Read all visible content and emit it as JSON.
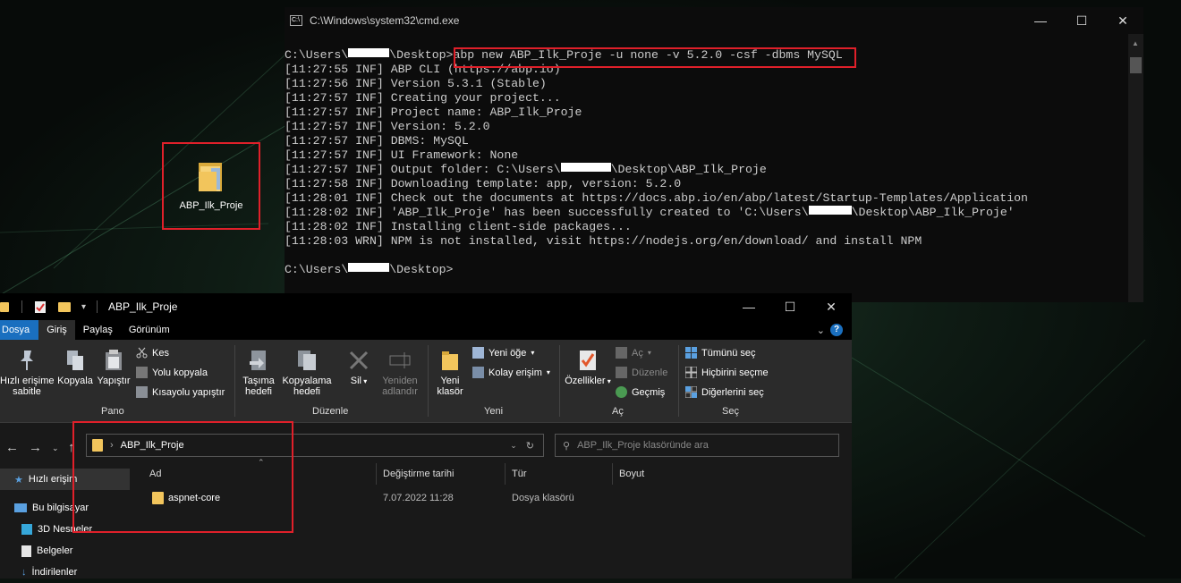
{
  "desktop": {
    "icon_label": "ABP_Ilk_Proje"
  },
  "cmd": {
    "title": "C:\\Windows\\system32\\cmd.exe",
    "prompt_pre": "C:\\Users\\",
    "prompt_post": "\\Desktop>",
    "command": "abp new ABP_Ilk_Proje -u none -v 5.2.0 -csf -dbms MySQL",
    "lines": [
      "[11:27:55 INF] ABP CLI (https://abp.io)",
      "[11:27:56 INF] Version 5.3.1 (Stable)",
      "[11:27:57 INF] Creating your project...",
      "[11:27:57 INF] Project name: ABP_Ilk_Proje",
      "[11:27:57 INF] Version: 5.2.0",
      "[11:27:57 INF] DBMS: MySQL",
      "[11:27:57 INF] UI Framework: None"
    ],
    "output_pre": "[11:27:57 INF] Output folder: C:\\Users\\",
    "output_post": "\\Desktop\\ABP_Ilk_Proje",
    "lines2": [
      "[11:27:58 INF] Downloading template: app, version: 5.2.0",
      "[11:28:01 INF] Check out the documents at https://docs.abp.io/en/abp/latest/Startup-Templates/Application"
    ],
    "created_pre": "[11:28:02 INF] 'ABP_Ilk_Proje' has been successfully created to 'C:\\Users\\",
    "created_post": "\\Desktop\\ABP_Ilk_Proje'",
    "lines3": [
      "[11:28:02 INF] Installing client-side packages...",
      "[11:28:03 WRN] NPM is not installed, visit https://nodejs.org/en/download/ and install NPM"
    ],
    "final_prompt_pre": "C:\\Users\\",
    "final_prompt_post": "\\Desktop>"
  },
  "explorer": {
    "title": "ABP_Ilk_Proje",
    "tabs": [
      "Dosya",
      "Giriş",
      "Paylaş",
      "Görünüm"
    ],
    "ribbon": {
      "pin": "Hızlı erişime\nsabitle",
      "copy": "Kopyala",
      "paste": "Yapıştır",
      "cut": "Kes",
      "copy_path": "Yolu kopyala",
      "paste_shortcut": "Kısayolu yapıştır",
      "group_pano": "Pano",
      "move_to": "Taşıma\nhedefi",
      "copy_to": "Kopyalama\nhedefi",
      "delete": "Sil",
      "rename": "Yeniden\nadlandır",
      "group_duzenle": "Düzenle",
      "new_folder": "Yeni\nklasör",
      "new_item": "Yeni öğe",
      "easy_access": "Kolay erişim",
      "group_yeni": "Yeni",
      "properties": "Özellikler",
      "open": "Aç",
      "edit": "Düzenle",
      "history": "Geçmiş",
      "group_ac": "Aç",
      "select_all": "Tümünü seç",
      "select_none": "Hiçbirini seçme",
      "invert": "Diğerlerini seç",
      "group_sec": "Seç"
    },
    "address": "ABP_Ilk_Proje",
    "search_placeholder": "ABP_Ilk_Proje klasöründe ara",
    "columns": [
      "Ad",
      "Değiştirme tarihi",
      "Tür",
      "Boyut"
    ],
    "rows": [
      {
        "name": "aspnet-core",
        "date": "7.07.2022 11:28",
        "type": "Dosya klasörü",
        "size": ""
      }
    ],
    "nav_pane": [
      "Hızlı erişim",
      "Bu bilgisayar",
      "3D Nesneler",
      "Belgeler",
      "İndirilenler"
    ]
  }
}
